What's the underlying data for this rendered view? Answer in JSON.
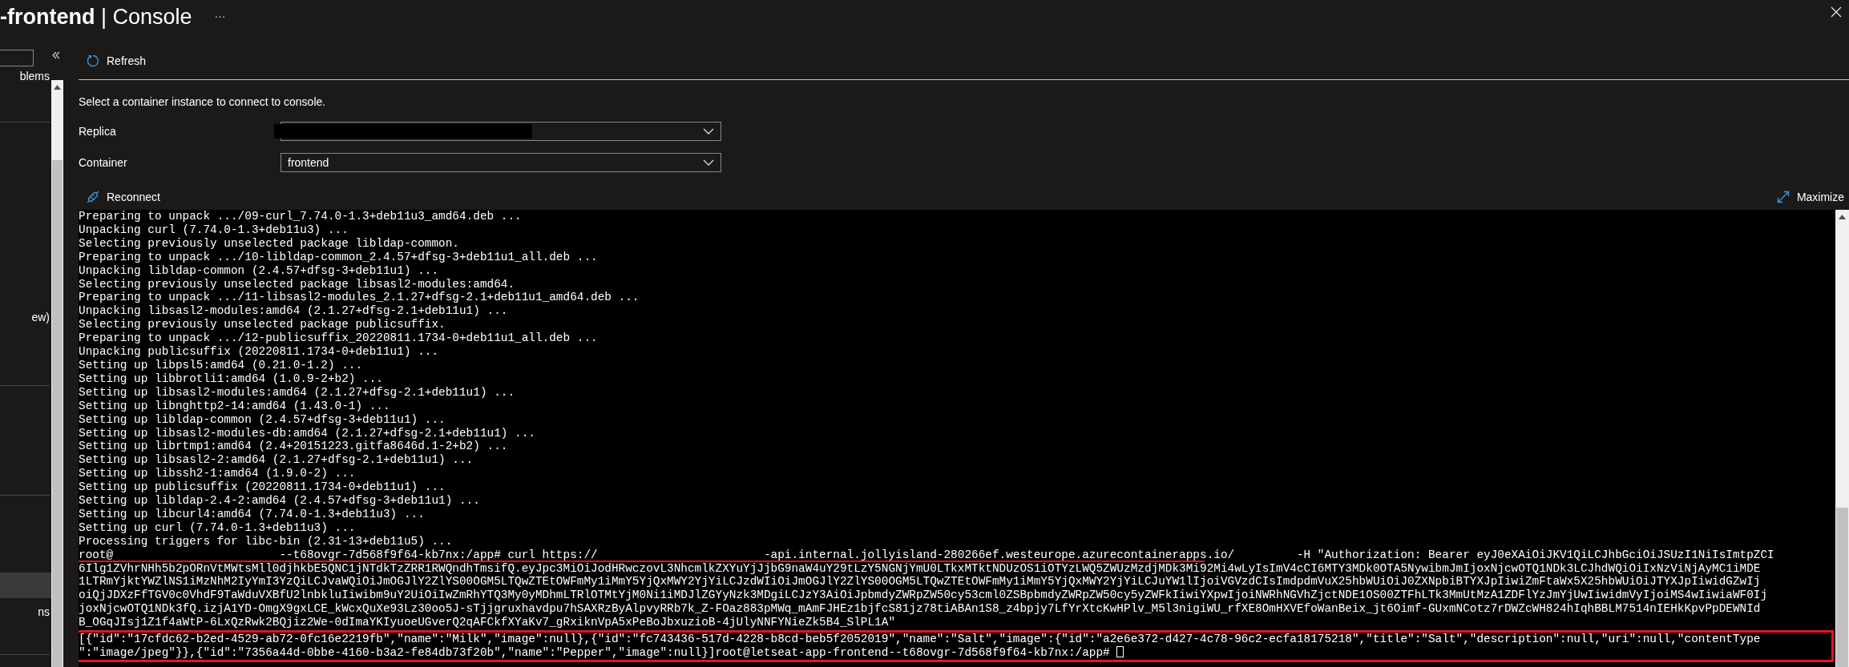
{
  "header": {
    "title": "**-frontend** | Console",
    "more": "···"
  },
  "sidebar": {
    "items": [
      {
        "label": "blems",
        "selected": false
      },
      {
        "label": "ew)",
        "selected": false
      },
      {
        "selected": true
      },
      {
        "label": "ns",
        "selected": false
      }
    ]
  },
  "toolbar": {
    "refresh": "Refresh"
  },
  "prompt": "Select a container instance to connect to console.",
  "fields": [
    {
      "label": "Replica",
      "redacted": true
    },
    {
      "label": "Container",
      "value": "frontend"
    }
  ],
  "actions": {
    "reconnect": "Reconnect",
    "maximize": "Maximize"
  },
  "terminal": {
    "lines": [
      "Preparing to unpack .../09-curl_7.74.0-1.3+deb11u3_amd64.deb ...",
      "Unpacking curl (7.74.0-1.3+deb11u3) ...",
      "Selecting previously unselected package libldap-common.",
      "Preparing to unpack .../10-libldap-common_2.4.57+dfsg-3+deb11u1_all.deb ...",
      "Unpacking libldap-common (2.4.57+dfsg-3+deb11u1) ...",
      "Selecting previously unselected package libsasl2-modules:amd64.",
      "Preparing to unpack .../11-libsasl2-modules_2.1.27+dfsg-2.1+deb11u1_amd64.deb ...",
      "Unpacking libsasl2-modules:amd64 (2.1.27+dfsg-2.1+deb11u1) ...",
      "Selecting previously unselected package publicsuffix.",
      "Preparing to unpack .../12-publicsuffix_20220811.1734-0+deb11u1_all.deb ...",
      "Unpacking publicsuffix (20220811.1734-0+deb11u1) ...",
      "Setting up libpsl5:amd64 (0.21.0-1.2) ...",
      "Setting up libbrotli1:amd64 (1.0.9-2+b2) ...",
      "Setting up libsasl2-modules:amd64 (2.1.27+dfsg-2.1+deb11u1) ...",
      "Setting up libnghttp2-14:amd64 (1.43.0-1) ...",
      "Setting up libldap-common (2.4.57+dfsg-3+deb11u1) ...",
      "Setting up libsasl2-modules-db:amd64 (2.1.27+dfsg-2.1+deb11u1) ...",
      "Setting up librtmp1:amd64 (2.4+20151223.gitfa8646d.1-2+b2) ...",
      "Setting up libsasl2-2:amd64 (2.1.27+dfsg-2.1+deb11u1) ...",
      "Setting up libssh2-1:amd64 (1.9.0-2) ...",
      "Setting up publicsuffix (20220811.1734-0+deb11u1) ...",
      "Setting up libldap-2.4-2:amd64 (2.4.57+dfsg-3+deb11u1) ...",
      "Setting up libcurl4:amd64 (7.74.0-1.3+deb11u3) ...",
      "Setting up curl (7.74.0-1.3+deb11u3) ...",
      "Processing triggers for libc-bin (2.31-13+deb11u5) ..."
    ],
    "command": {
      "underlined": true,
      "segments": [
        {
          "kind": "text",
          "text": "root@"
        },
        {
          "kind": "redacted_long"
        },
        {
          "kind": "text",
          "text": "--t68ovgr-7d568f9f64-kb7nx:/app# curl https://"
        },
        {
          "kind": "redacted_long"
        },
        {
          "kind": "text",
          "text": "-api.internal.jollyisland-280266ef.westeurope.azurecontainerapps.io/"
        },
        {
          "kind": "redacted_short"
        },
        {
          "kind": "text",
          "text": "-H \"Authorization: Bearer eyJ0eXAiOiJKV1QiLCJhbGciOiJSUzI1NiIsImtpZCI"
        }
      ]
    },
    "token_lines": [
      "6Ilg1ZVhrNHh5b2pORnVtMWtsMll0djhkbE5QNC1jNTdkTzZRR1RWQndhTmsifQ.eyJpc3MiOiJodHRwczovL3NhcmlkZXYuYjJjbG9naW4uY29tLzY5NGNjYmU0LTkxMTktNDUzOS1iOTYzLWQ5ZWUzMzdjMDk3Mi92Mi4wLyIsImV4cCI6MTY3MDk0OTA5NywibmJmIjoxNjcwOTQ1NDk3LCJhdWQiOiIxNzViNjAyMC1iMDE",
      "1LTRmYjktYWZlNS1iMzNhM2IyYmI3YzQiLCJvaWQiOiJmOGJlY2ZlYS00OGM5LTQwZTEtOWFmMy1iMmY5YjQxMWY2YjYiLCJzdWIiOiJmOGJlY2ZlYS00OGM5LTQwZTEtOWFmMy1iMmY5YjQxMWY2YjYiLCJuYW1lIjoiVGVzdCIsImdpdmVuX25hbWUiOiJ0ZXNpbiBTYXJpIiwiZmFtaWx5X25hbWUiOiJTYXJpIiwidGZwIj",
      "oiQjJDXzFfTGV0c0VhdF9TaWduVXBfU2lnbkluIiwibm9uY2UiOiIwZmRhYTQ3My0yMDhmLTRlOTMtYjM0Ni1iMDJlZGYyNzk3MDgiLCJzY3AiOiJpbmdyZWRpZW50cy53cml0ZSBpbmdyZWRpZW50cy5yZWFkIiwiYXpwIjoiNWRhNGVhZjctNDE1OS00ZTFhLTk3MmUtMzA1ZDFlYzJmYjUwIiwidmVyIjoiMS4wIiwiaWF0Ij",
      "joxNjcwOTQ1NDk3fQ.izjA1YD-OmgX9gxLCE_kWcxQuXe93Lz30oo5J-sTjjgruxhavdpu7hSAXRzByAlpvyRRb7k_Z-FOaz883pMWq_mAmFJHEz1bjfcS81jz78tiABAn1S8_z4bpjy7LfYrXtcKwHPlv_M5l3nigiWU_rfXE8OmHXVEfoWanBeix_jt6Oimf-GUxmNCotz7rDWZcWH824hIqhBBLM7514nIEHkKpvPpDEWNId",
      "B_OGqJIsj1Z1f4aWtP-6LxQzRwk2BQjiz2We-0dImaYKIyuoeUGverQ2qAFCkfXYaKv7_gRxiknVpA5xPeBoJbxuzioB-4jUlyNNFYNieZk5B4_SlPL1A\""
    ],
    "result": {
      "framed": true,
      "cursor": true,
      "lines": [
        "[{\"id\":\"17cfdc62-b2ed-4529-ab72-0fc16e2219fb\",\"name\":\"Milk\",\"image\":null},{\"id\":\"fc743436-517d-4228-b8cd-beb5f2052019\",\"name\":\"Salt\",\"image\":{\"id\":\"a2e6e372-d427-4c78-96c2-ecfa18175218\",\"title\":\"Salt\",\"description\":null,\"uri\":null,\"contentType",
        "\":\"image/jpeg\"}},{\"id\":\"7356a44d-0bbe-4160-b3a2-fe84db73f20b\",\"name\":\"Pepper\",\"image\":null}]root@letseat-app-frontend--t68ovgr-7d568f9f64-kb7nx:/app# "
      ]
    }
  }
}
